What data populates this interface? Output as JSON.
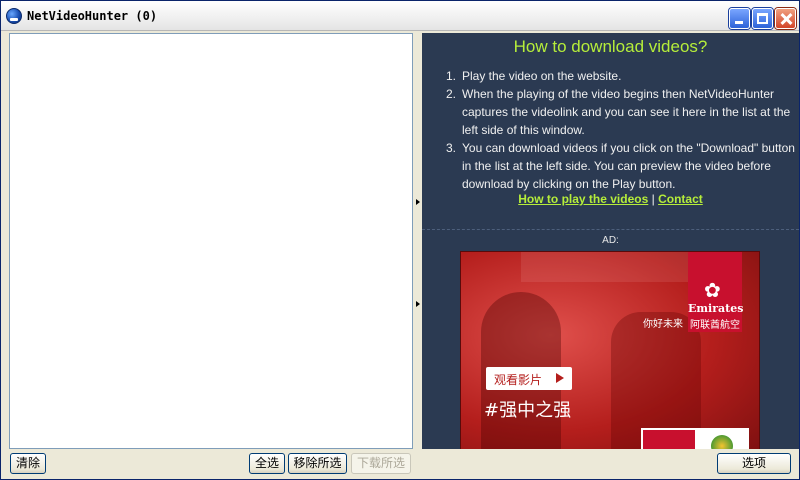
{
  "window": {
    "title": "NetVideoHunter  (0)"
  },
  "help": {
    "title": "How to download videos?",
    "steps": [
      {
        "num": "1.",
        "text": "Play the video on the website."
      },
      {
        "num": "2.",
        "text": "When the playing of the video begins then NetVideoHunter captures the videolink and you can see it here in the list at the left side of this window."
      },
      {
        "num": "3.",
        "text": "You can download videos if you click on the \"Download\" button in the list at the left side. You can preview the video before download by clicking on the Play button."
      }
    ],
    "link_play": "How to play the videos",
    "link_separator": " | ",
    "link_contact": "Contact"
  },
  "ad": {
    "label": "AD:",
    "brand_en": "Emirates",
    "brand_cn": "阿联酋航空",
    "tagline": "你好未来",
    "cta": "观看影片",
    "hashtag": "#强中之强"
  },
  "buttons": {
    "clear": "清除",
    "select_all": "全选",
    "remove_selected": "移除所选",
    "download_selected": "下载所选",
    "options": "选项"
  },
  "colors": {
    "panel_bg": "#2b3a52",
    "accent_green": "#b6ee3a",
    "ad_red": "#c8102e"
  }
}
